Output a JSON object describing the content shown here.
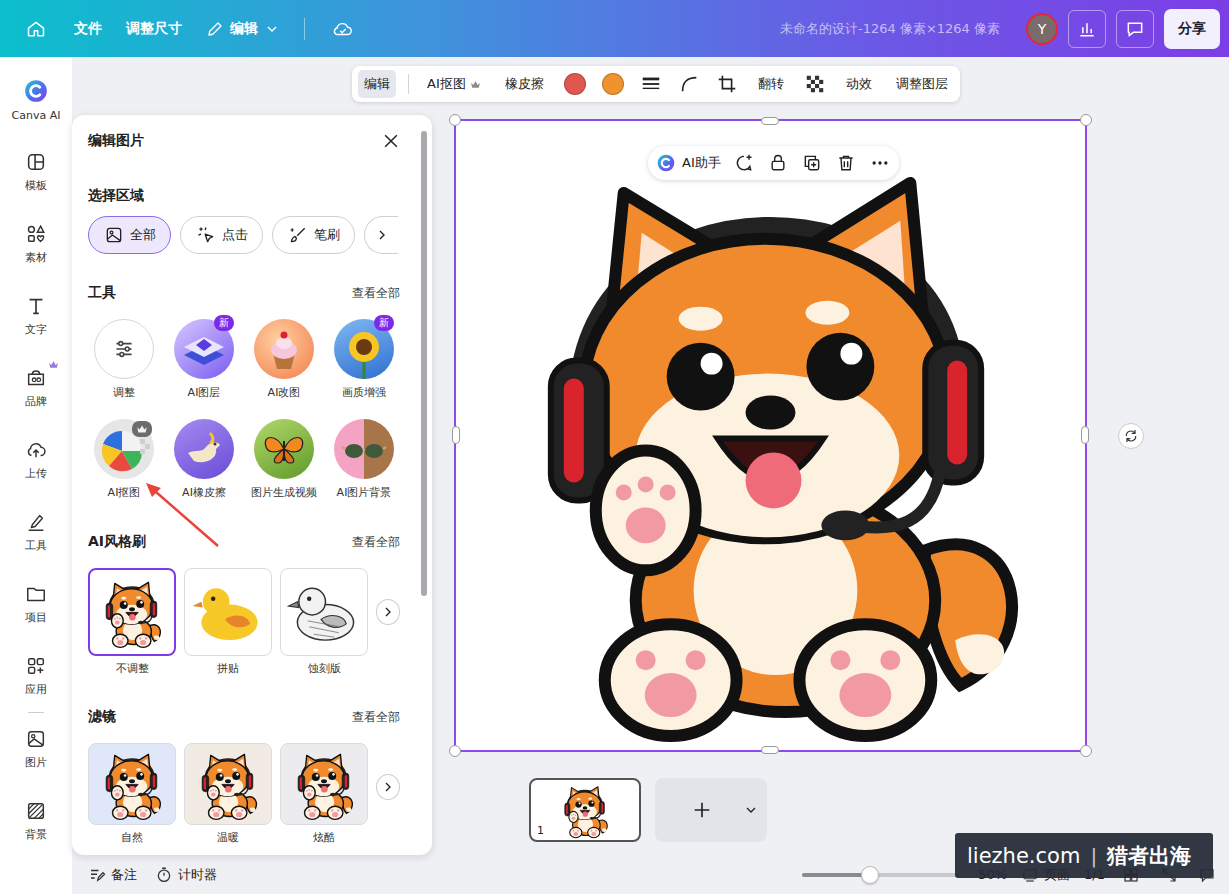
{
  "topbar": {
    "nav": [
      {
        "label": "文件",
        "dropdown": false
      },
      {
        "label": "调整尺寸",
        "dropdown": false
      },
      {
        "label": "编辑",
        "dropdown": true
      }
    ],
    "title": "未命名的设计-1264 像素×1264 像素",
    "avatar": "Y",
    "share": "分享"
  },
  "rail": {
    "main": [
      {
        "label": "Canva AI",
        "kind": "ai",
        "premium": false
      },
      {
        "label": "模板",
        "kind": "templates",
        "premium": false
      },
      {
        "label": "素材",
        "kind": "elements",
        "premium": false
      },
      {
        "label": "文字",
        "kind": "text",
        "premium": false
      },
      {
        "label": "品牌",
        "kind": "brand",
        "premium": true
      },
      {
        "label": "上传",
        "kind": "upload",
        "premium": false
      },
      {
        "label": "工具",
        "kind": "tools",
        "premium": false
      },
      {
        "label": "项目",
        "kind": "projects",
        "premium": false
      },
      {
        "label": "应用",
        "kind": "apps",
        "premium": false
      }
    ],
    "extra": [
      {
        "label": "图片",
        "kind": "photos",
        "premium": false
      },
      {
        "label": "背景",
        "kind": "background",
        "premium": false
      }
    ]
  },
  "panel": {
    "title": "编辑图片",
    "select": {
      "heading": "选择区域",
      "options": [
        {
          "label": "全部",
          "kind": "all",
          "selected": true
        },
        {
          "label": "点击",
          "kind": "click",
          "selected": false
        },
        {
          "label": "笔刷",
          "kind": "brush",
          "selected": false
        }
      ]
    },
    "tools": {
      "heading": "工具",
      "view_all": "查看全部",
      "items": [
        {
          "label": "调整",
          "kind": "adjust",
          "badge": "",
          "premium": false
        },
        {
          "label": "AI图层",
          "kind": "layers",
          "badge": "新",
          "premium": false
        },
        {
          "label": "AI改图",
          "kind": "edit",
          "badge": "",
          "premium": false
        },
        {
          "label": "画质增强",
          "kind": "enhance",
          "badge": "新",
          "premium": false
        },
        {
          "label": "AI抠图",
          "kind": "cutout",
          "badge": "",
          "premium": true
        },
        {
          "label": "AI橡皮擦",
          "kind": "eraser",
          "badge": "",
          "premium": false
        },
        {
          "label": "图片生成视频",
          "kind": "video",
          "badge": "",
          "premium": false
        },
        {
          "label": "AI图片背景",
          "kind": "background",
          "badge": "",
          "premium": false
        }
      ]
    },
    "styles": {
      "heading": "AI风格刷",
      "view_all": "查看全部",
      "items": [
        {
          "label": "不调整",
          "kind": "dog",
          "selected": true
        },
        {
          "label": "拼贴",
          "kind": "duck",
          "selected": false
        },
        {
          "label": "蚀刻版",
          "kind": "sketch",
          "selected": false
        }
      ]
    },
    "filters": {
      "heading": "滤镜",
      "view_all": "查看全部",
      "items": [
        {
          "label": "自然",
          "selected": false,
          "color": "#dfe7f8"
        },
        {
          "label": "温暖",
          "selected": false,
          "color": "#f2ebe4"
        },
        {
          "label": "炫酷",
          "selected": false,
          "color": "#ececee"
        }
      ]
    }
  },
  "toolbar": {
    "mode": {
      "label": "编辑",
      "selected": true
    },
    "items": [
      {
        "kind": "text",
        "label": "AI抠图",
        "premium": true
      },
      {
        "kind": "text",
        "label": "橡皮擦",
        "premium": false
      },
      {
        "kind": "color",
        "color": "#e0574f"
      },
      {
        "kind": "color",
        "color": "#f0922e"
      },
      {
        "kind": "stroke"
      },
      {
        "kind": "corner"
      },
      {
        "kind": "crop"
      },
      {
        "kind": "text",
        "label": "翻转",
        "premium": false
      },
      {
        "kind": "transparency"
      },
      {
        "kind": "text",
        "label": "动效",
        "premium": false
      },
      {
        "kind": "text",
        "label": "调整图层",
        "premium": false
      }
    ]
  },
  "canvas": {
    "assistant": "AI助手"
  },
  "pages": [
    {
      "number": "1",
      "selected": true
    }
  ],
  "bottom": {
    "notes": "备注",
    "timer": "计时器",
    "zoom": {
      "level": 0.43,
      "reading": "50%"
    },
    "pages_label": "页面",
    "page_count": "1/1"
  },
  "watermark": {
    "domain": "liezhe.com",
    "divider": "|",
    "name": "猎者出海"
  }
}
